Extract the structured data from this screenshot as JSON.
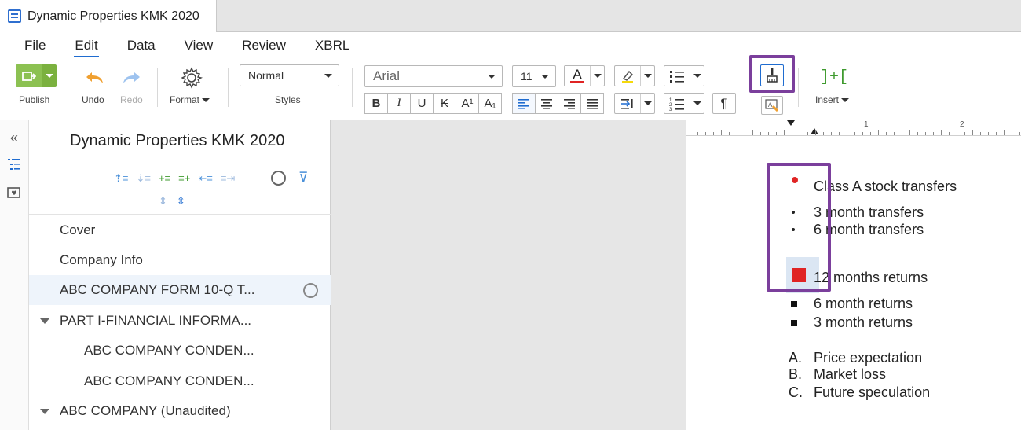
{
  "tab": {
    "title": "Dynamic Properties KMK 2020"
  },
  "menu": {
    "items": [
      "File",
      "Edit",
      "Data",
      "View",
      "Review",
      "XBRL"
    ],
    "active": "Edit"
  },
  "toolbar": {
    "publish_label": "Publish",
    "undo_label": "Undo",
    "redo_label": "Redo",
    "format_label": "Format",
    "style_value": "Normal",
    "styles_label": "Styles",
    "font_value": "Arial",
    "size_value": "11",
    "insert_label": "Insert",
    "insert_glyph": "]+[",
    "bold": "B",
    "italic": "I",
    "underline": "U",
    "strike": "K",
    "superscript": "A¹",
    "subscript": "A₁",
    "pilcrow": "¶",
    "font_color_glyph": "A"
  },
  "outline": {
    "title": "Dynamic Properties KMK 2020",
    "items": [
      {
        "label": "Cover",
        "indent": 0,
        "caret": false
      },
      {
        "label": "Company Info",
        "indent": 0,
        "caret": false
      },
      {
        "label": "ABC COMPANY FORM 10-Q T...",
        "indent": 0,
        "caret": false,
        "selected": true,
        "circle": true
      },
      {
        "label": "PART I-FINANCIAL INFORMA...",
        "indent": 0,
        "caret": true
      },
      {
        "label": "ABC COMPANY CONDEN...",
        "indent": 1,
        "caret": false
      },
      {
        "label": "ABC COMPANY CONDEN...",
        "indent": 1,
        "caret": false
      },
      {
        "label": "ABC COMPANY (Unaudited)",
        "indent": 0,
        "caret": true
      }
    ]
  },
  "ruler": {
    "numbers": [
      "1",
      "2"
    ]
  },
  "document": {
    "list1": [
      "Class A stock transfers",
      "3 month transfers",
      "6 month transfers"
    ],
    "list2": [
      "12 months returns",
      "6 month returns",
      "3 month returns"
    ],
    "list3": [
      {
        "marker": "A.",
        "text": "Price expectation"
      },
      {
        "marker": "B.",
        "text": "Market loss"
      },
      {
        "marker": "C.",
        "text": "Future speculation"
      }
    ]
  },
  "colors": {
    "accent_blue": "#1f6cd0",
    "publish_green": "#8cc152",
    "highlight_purple": "#7b3f9c",
    "bullet_red": "#e02424",
    "undo_orange": "#f0a030"
  }
}
